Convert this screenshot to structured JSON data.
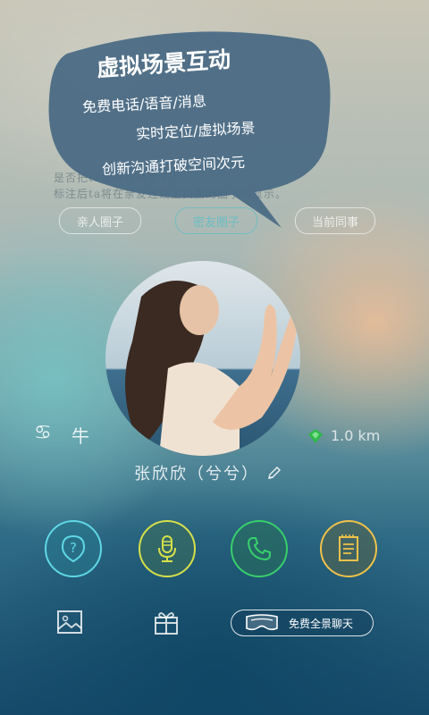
{
  "faded_prompt": {
    "line1": "是否把ta显示在列圈子？",
    "line2": "标注后ta将在亲友连线主页面的圈子中显示。"
  },
  "circle_tags": [
    {
      "label": "亲人圈子"
    },
    {
      "label": "密友圈子"
    },
    {
      "label": "当前同事"
    }
  ],
  "promo_bubble": {
    "title": "虚拟场景互动",
    "line1": "免费电话/语音/消息",
    "line2": "实时定位/虚拟场景",
    "line3": "创新沟通打破空间次元"
  },
  "profile": {
    "zodiac_icon": "cancer-zodiac-icon",
    "zodiac_animal": "牛",
    "distance": "1.0 km",
    "name": "张欣欣（兮兮）"
  },
  "actions": [
    {
      "name": "question",
      "color": "#5fd8e6"
    },
    {
      "name": "microphone",
      "color": "#d6e04a"
    },
    {
      "name": "phone",
      "color": "#37d06a"
    },
    {
      "name": "notes",
      "color": "#f0c24a"
    }
  ],
  "bottom_bar": {
    "vr_chat_label": "免费全景聊天"
  }
}
